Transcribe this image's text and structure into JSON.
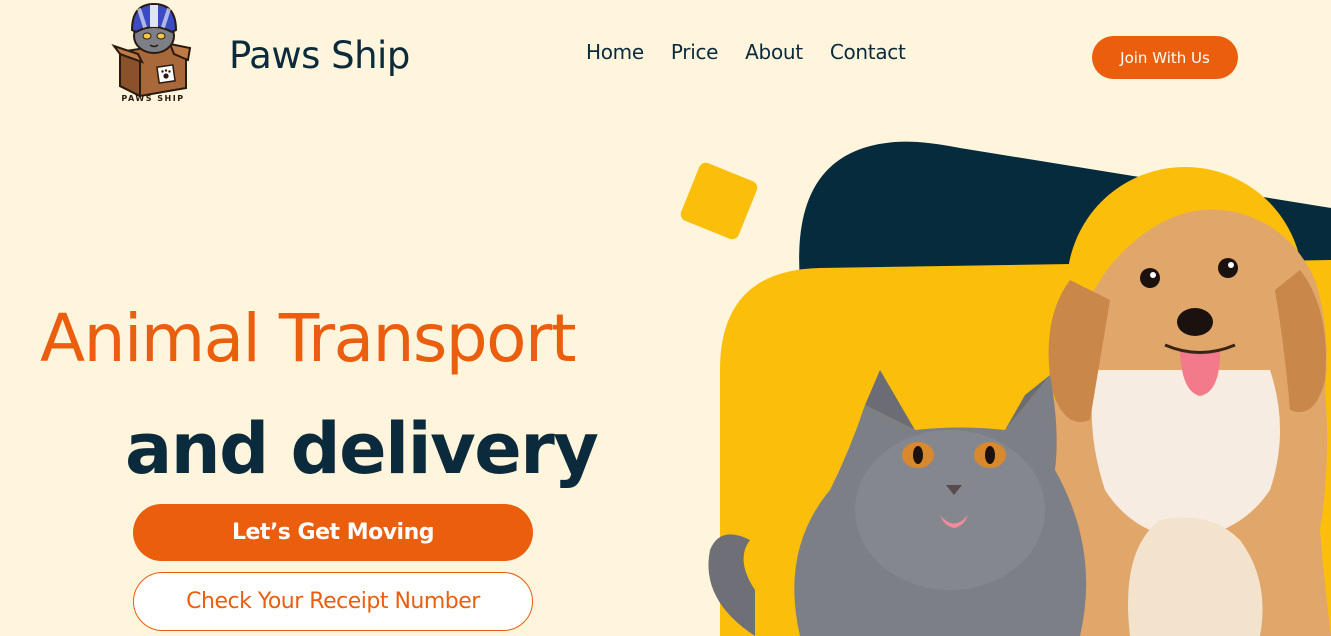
{
  "header": {
    "brand_name": "Paws Ship",
    "logo_text": "PAWS SHIP",
    "nav": [
      {
        "label": "Home"
      },
      {
        "label": "Price"
      },
      {
        "label": "About"
      },
      {
        "label": "Contact"
      }
    ],
    "join_label": "Join With Us"
  },
  "hero": {
    "headline_line1": "Animal Transport",
    "headline_line2": "and delivery",
    "primary_cta": "Let’s Get Moving",
    "secondary_cta": "Check Your Receipt Number",
    "image_subjects": [
      "cat-photo",
      "dog-photo"
    ]
  },
  "colors": {
    "background": "#fef5dc",
    "accent_orange": "#ea5e0d",
    "navy": "#0b2a3c",
    "yellow": "#fbbf0b"
  }
}
